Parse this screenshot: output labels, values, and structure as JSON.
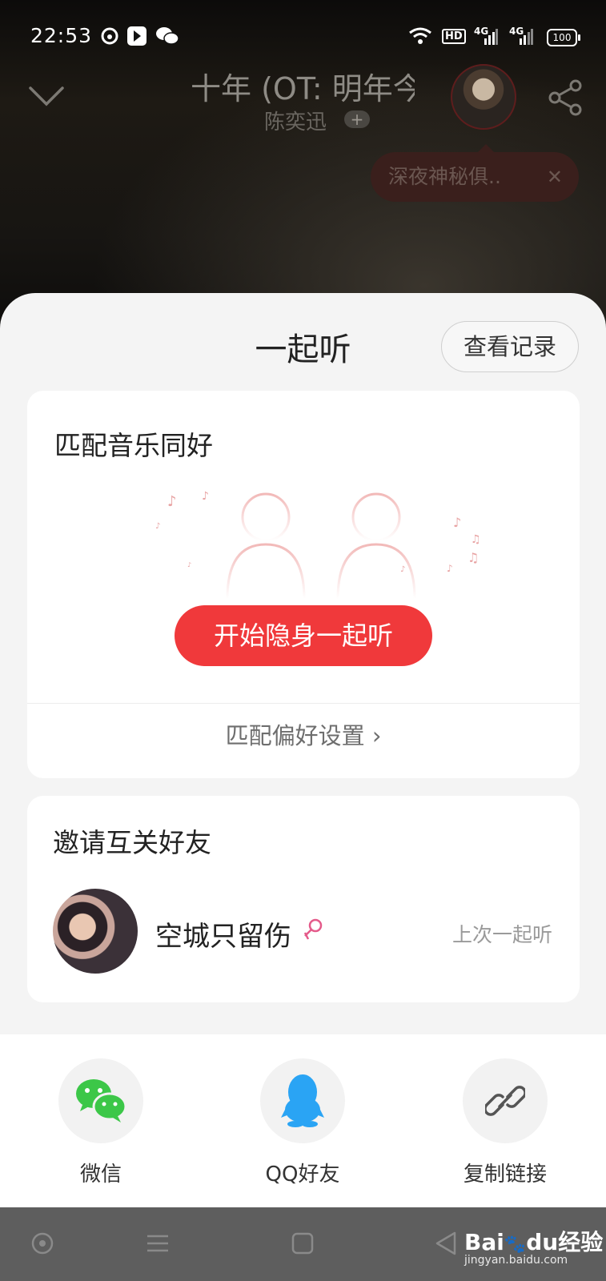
{
  "status_bar": {
    "time": "22:53",
    "battery": "100",
    "icons": [
      "netease-music-icon",
      "video-app-icon",
      "wechat-icon",
      "wifi-icon",
      "hd-icon",
      "signal-4g-icon",
      "signal-4g-icon"
    ],
    "signal_labels": [
      "HD",
      "4G",
      "4G"
    ]
  },
  "player": {
    "song_title": "十年 (OT: 明年今",
    "singer": "陈奕迅",
    "singer_add": "+",
    "club_tip": "深夜神秘俱..",
    "club_close": "✕"
  },
  "sheet": {
    "title": "一起听",
    "record_button": "查看记录"
  },
  "match_card": {
    "title": "匹配音乐同好",
    "start_button": "开始隐身一起听",
    "pref_link": "匹配偏好设置",
    "pref_arrow": "›"
  },
  "invite_card": {
    "title": "邀请互关好友",
    "friends": [
      {
        "name": "空城只留伤",
        "action": "上次一起听"
      }
    ]
  },
  "share_options": [
    {
      "label": "微信",
      "icon": "wechat-icon",
      "color": "#3cc748"
    },
    {
      "label": "QQ好友",
      "icon": "qq-icon",
      "color": "#2aa4f4"
    },
    {
      "label": "复制链接",
      "icon": "link-icon",
      "color": "#555555"
    }
  ],
  "nav_bar": {
    "icons": [
      "circle-icon",
      "menu-icon",
      "square-icon",
      "back-icon"
    ]
  },
  "watermark": {
    "brand": "Bai",
    "brand_tail": "du经验",
    "url": "jingyan.baidu.com"
  },
  "colors": {
    "accent": "#f0393b",
    "female": "#e45a8a"
  }
}
